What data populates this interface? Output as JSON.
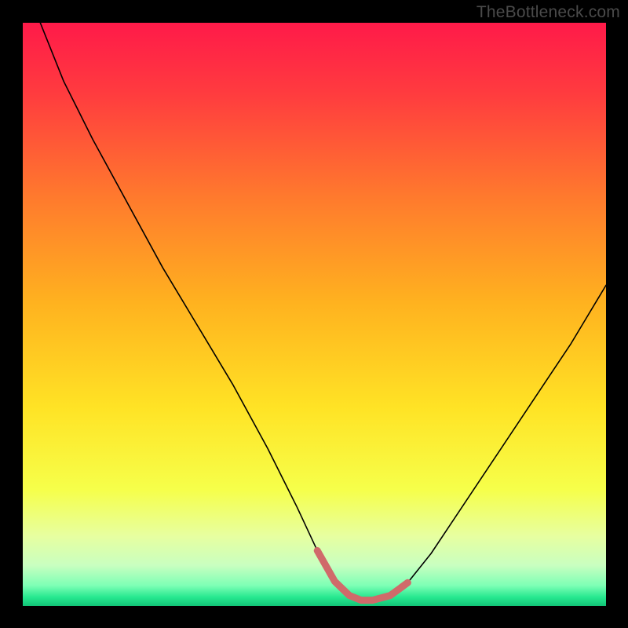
{
  "watermark": "TheBottleneck.com",
  "chart_data": {
    "type": "line",
    "title": "",
    "xlabel": "",
    "ylabel": "",
    "xlim": [
      0,
      100
    ],
    "ylim": [
      0,
      100
    ],
    "background_gradient": {
      "stops": [
        {
          "pos": 0.0,
          "color": "#ff1a49"
        },
        {
          "pos": 0.12,
          "color": "#ff3b3f"
        },
        {
          "pos": 0.3,
          "color": "#ff7a2d"
        },
        {
          "pos": 0.48,
          "color": "#ffb21f"
        },
        {
          "pos": 0.66,
          "color": "#ffe325"
        },
        {
          "pos": 0.8,
          "color": "#f6ff4a"
        },
        {
          "pos": 0.88,
          "color": "#e7ffa0"
        },
        {
          "pos": 0.93,
          "color": "#c9ffc0"
        },
        {
          "pos": 0.965,
          "color": "#7dffb5"
        },
        {
          "pos": 0.985,
          "color": "#26e88f"
        },
        {
          "pos": 1.0,
          "color": "#12c477"
        }
      ]
    },
    "series": [
      {
        "name": "bottleneck-curve",
        "color": "#000000",
        "width": 1.6,
        "x": [
          3.0,
          7,
          12,
          18,
          24,
          30,
          36,
          42,
          47,
          50.5,
          53.5,
          56,
          58,
          60,
          63,
          66,
          70,
          74,
          78,
          82,
          86,
          90,
          94,
          97,
          100
        ],
        "y": [
          100,
          90,
          80,
          69,
          58,
          48,
          38,
          27,
          17,
          9.5,
          4.2,
          1.8,
          1.0,
          1.0,
          1.8,
          4.0,
          9.0,
          15,
          21,
          27,
          33,
          39,
          45,
          50,
          55
        ]
      }
    ],
    "highlight": {
      "name": "optimal-zone",
      "color": "#d06a6a",
      "width": 9,
      "cap": "round",
      "x": [
        50.5,
        53.5,
        56,
        58,
        60,
        63,
        66
      ],
      "y": [
        9.5,
        4.2,
        1.8,
        1.0,
        1.0,
        1.8,
        4.0
      ]
    }
  }
}
